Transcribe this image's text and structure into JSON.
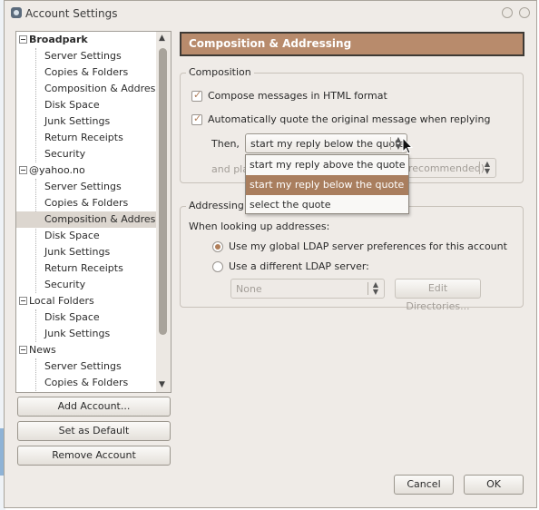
{
  "window": {
    "title": "Account Settings"
  },
  "tree": {
    "items": [
      {
        "label": "Broadpark",
        "type": "account"
      },
      {
        "label": "Server Settings",
        "type": "child"
      },
      {
        "label": "Copies & Folders",
        "type": "child"
      },
      {
        "label": "Composition & Addres...",
        "type": "child"
      },
      {
        "label": "Disk Space",
        "type": "child"
      },
      {
        "label": "Junk Settings",
        "type": "child"
      },
      {
        "label": "Return Receipts",
        "type": "child"
      },
      {
        "label": "Security",
        "type": "child"
      },
      {
        "label": "@yahoo.no",
        "type": "account"
      },
      {
        "label": "Server Settings",
        "type": "child"
      },
      {
        "label": "Copies & Folders",
        "type": "child"
      },
      {
        "label": "Composition & Addres...",
        "type": "child",
        "selected": true
      },
      {
        "label": "Disk Space",
        "type": "child"
      },
      {
        "label": "Junk Settings",
        "type": "child"
      },
      {
        "label": "Return Receipts",
        "type": "child"
      },
      {
        "label": "Security",
        "type": "child"
      },
      {
        "label": "Local Folders",
        "type": "account"
      },
      {
        "label": "Disk Space",
        "type": "child"
      },
      {
        "label": "Junk Settings",
        "type": "child"
      },
      {
        "label": "News",
        "type": "account"
      },
      {
        "label": "Server Settings",
        "type": "child"
      },
      {
        "label": "Copies & Folders",
        "type": "child"
      }
    ]
  },
  "left_buttons": {
    "add_account": "Add Account...",
    "set_default": "Set as Default",
    "remove_account": "Remove Account"
  },
  "panel": {
    "title": "Composition & Addressing",
    "composition": {
      "legend": "Composition",
      "html_format": {
        "label": "Compose messages in HTML format",
        "checked": true
      },
      "auto_quote": {
        "label": "Automatically quote the original message when replying",
        "checked": true
      },
      "then_label": "Then,",
      "reply_select_value": "start my reply below the quote",
      "place_label_partial": "and pla",
      "signature_select_partial": "recommended)",
      "reply_options": [
        "start my reply above the quote",
        "start my reply below the quote",
        "select the quote"
      ],
      "highlighted_option": 1
    },
    "addressing": {
      "legend": "Addressing",
      "when_label": "When looking up addresses:",
      "use_global": {
        "label": "Use my global LDAP server preferences for this account",
        "checked": true
      },
      "use_different": {
        "label": "Use a different LDAP server:",
        "checked": false
      },
      "server_select_value": "None",
      "edit_directories": "Edit Directories..."
    }
  },
  "footer": {
    "cancel": "Cancel",
    "ok": "OK"
  },
  "colors": {
    "header_bg": "#b88b6c",
    "highlight": "#a97e5e",
    "accent_check": "#b07e5a"
  }
}
